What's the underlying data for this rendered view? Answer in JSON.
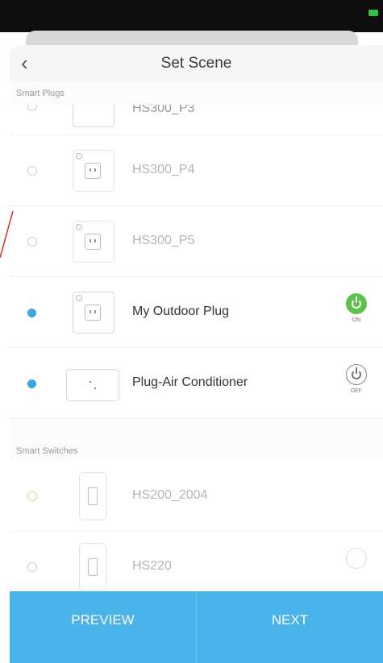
{
  "header": {
    "title": "Set Scene",
    "back_icon": "chevron-left-icon"
  },
  "sections": {
    "smart_plugs_label": "Smart Plugs",
    "smart_switches_label": "Smart Switches"
  },
  "plugs": [
    {
      "name": "HS300_P3",
      "selected": false,
      "partial": true
    },
    {
      "name": "HS300_P4",
      "selected": false
    },
    {
      "name": "HS300_P5",
      "selected": false
    },
    {
      "name": "My Outdoor Plug",
      "selected": true,
      "power": "ON"
    },
    {
      "name": "Plug-Air Conditioner",
      "selected": true,
      "power": "OFF"
    }
  ],
  "switches": [
    {
      "name": "HS200_2004",
      "selected": false,
      "disabled": true
    },
    {
      "name": "HS220",
      "selected": false
    }
  ],
  "footer": {
    "preview_label": "PREVIEW",
    "next_label": "NEXT"
  },
  "colors": {
    "accent": "#4ab3ea",
    "on": "#5cc24a",
    "selected": "#3ba6e3",
    "header_bg": "#0e0e0e"
  }
}
